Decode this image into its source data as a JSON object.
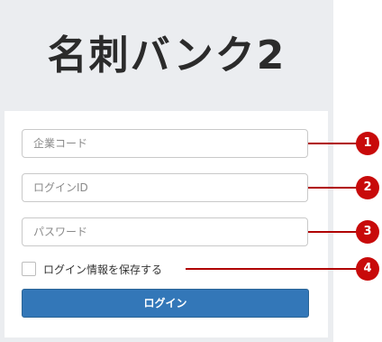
{
  "app": {
    "title": "名刺バンク2"
  },
  "form": {
    "company_code": {
      "placeholder": "企業コード",
      "value": ""
    },
    "login_id": {
      "placeholder": "ログインID",
      "value": ""
    },
    "password": {
      "placeholder": "パスワード",
      "value": ""
    },
    "remember": {
      "label": "ログイン情報を保存する",
      "checked": false
    },
    "login_button": "ログイン"
  },
  "callouts": [
    "1",
    "2",
    "3",
    "4"
  ],
  "colors": {
    "button": "#3377b8",
    "callout": "#c80a0a",
    "panel": "#ebedf0"
  }
}
